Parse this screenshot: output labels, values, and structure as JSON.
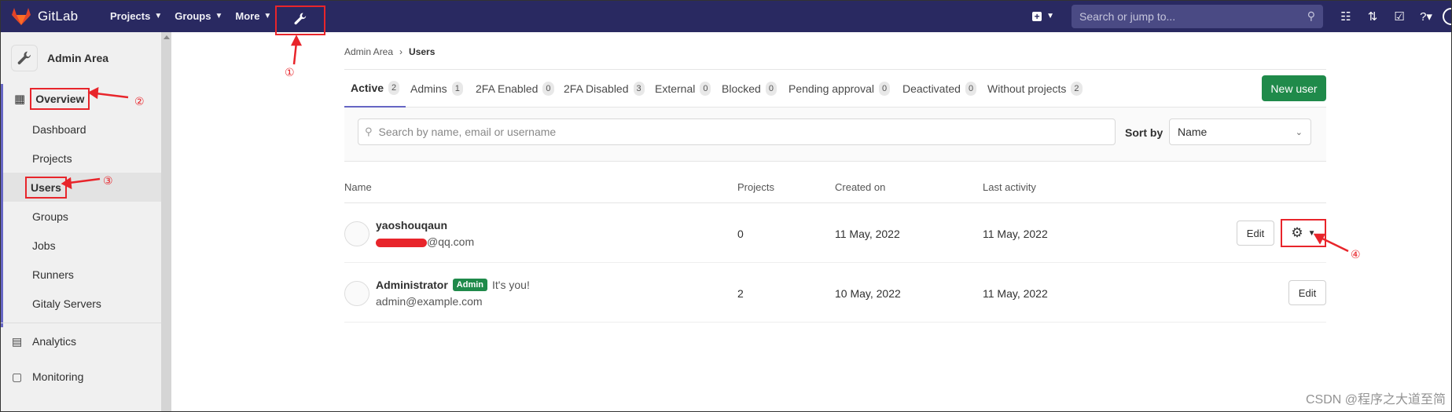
{
  "topbar": {
    "brand": "GitLab",
    "nav": [
      {
        "label": "Projects"
      },
      {
        "label": "Groups"
      },
      {
        "label": "More"
      }
    ],
    "search_placeholder": "Search or jump to..."
  },
  "sidebar": {
    "title": "Admin Area",
    "overview_label": "Overview",
    "sub_items": [
      "Dashboard",
      "Projects",
      "Users",
      "Groups",
      "Jobs",
      "Runners",
      "Gitaly Servers"
    ],
    "analytics_label": "Analytics",
    "monitoring_label": "Monitoring"
  },
  "annotations": [
    "①",
    "②",
    "③",
    "④"
  ],
  "breadcrumbs": {
    "root": "Admin Area",
    "current": "Users"
  },
  "tabs": [
    {
      "label": "Active",
      "count": "2"
    },
    {
      "label": "Admins",
      "count": "1"
    },
    {
      "label": "2FA Enabled",
      "count": "0"
    },
    {
      "label": "2FA Disabled",
      "count": "3"
    },
    {
      "label": "External",
      "count": "0"
    },
    {
      "label": "Blocked",
      "count": "0"
    },
    {
      "label": "Pending approval",
      "count": "0"
    },
    {
      "label": "Deactivated",
      "count": "0"
    },
    {
      "label": "Without projects",
      "count": "2"
    }
  ],
  "new_user_label": "New user",
  "filter": {
    "search_placeholder": "Search by name, email or username",
    "sort_label": "Sort by",
    "sort_value": "Name"
  },
  "table": {
    "headers": [
      "Name",
      "Projects",
      "Created on",
      "Last activity"
    ],
    "rows": [
      {
        "name": "yaoshouqaun",
        "email_suffix": "@qq.com",
        "projects": "0",
        "created": "11 May, 2022",
        "last_activity": "11 May, 2022",
        "edit": "Edit"
      },
      {
        "name": "Administrator",
        "badge": "Admin",
        "note": "It's you!",
        "email": "admin@example.com",
        "projects": "2",
        "created": "10 May, 2022",
        "last_activity": "11 May, 2022",
        "edit": "Edit"
      }
    ]
  },
  "watermark": "CSDN @程序之大道至简",
  "colors": {
    "topbar": "#292961",
    "accent": "#6666c4",
    "annotation_red": "#e8252b",
    "success": "#1f8a4a"
  }
}
